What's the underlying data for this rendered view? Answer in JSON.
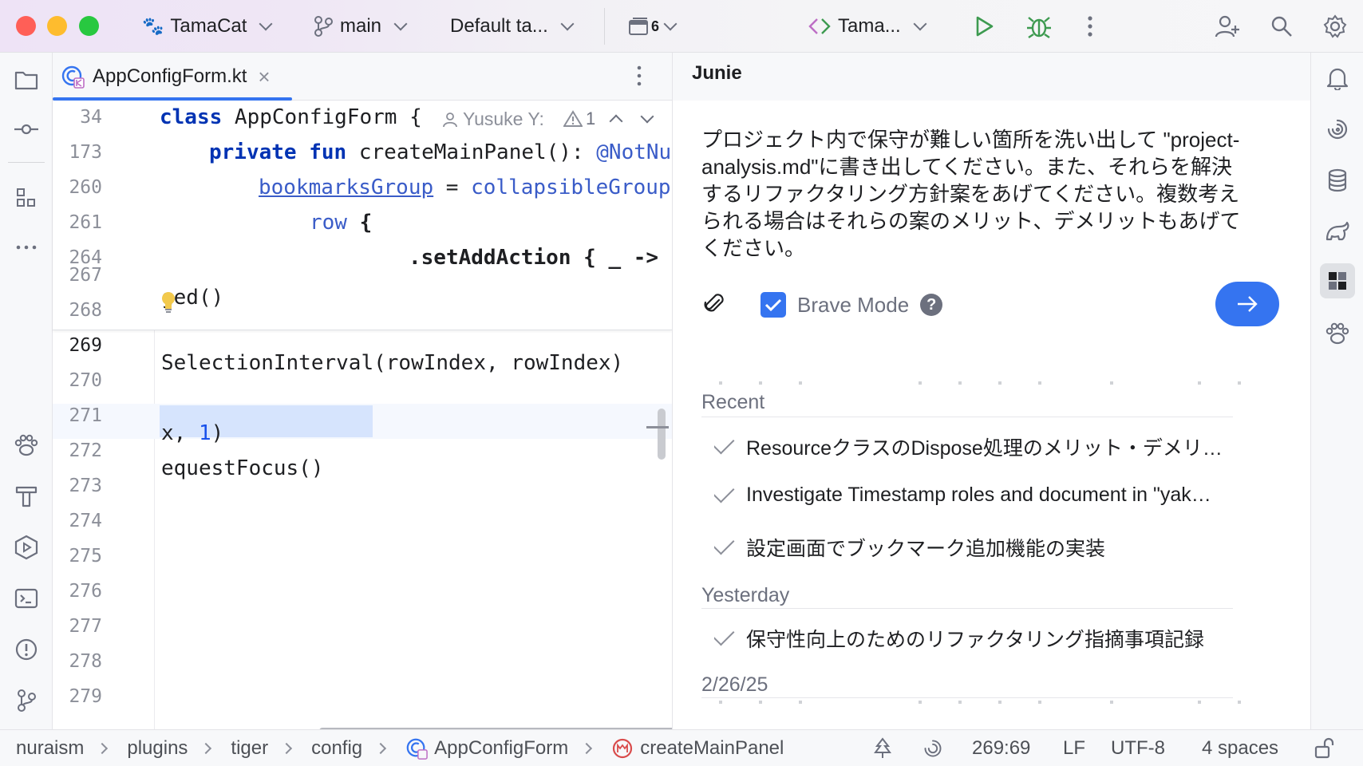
{
  "titlebar": {
    "project": "TamaCat",
    "branch": "main",
    "task": "Default ta...",
    "windows_count": "6",
    "run_config": "Tama...",
    "colors": {
      "close": "#ff5f57",
      "minimize": "#febc2e",
      "maximize": "#28c840",
      "run": "#3d9a50",
      "debug": "#3d9a50"
    }
  },
  "left_strip": {
    "items": [
      "project-icon",
      "commit-icon",
      "structure-icon",
      "more-icon",
      "paw-icon",
      "build-icon",
      "run-icon",
      "terminal-icon",
      "problems-icon",
      "git-icon"
    ]
  },
  "right_strip": {
    "items": [
      "notifications-icon",
      "ai-assistant-icon",
      "database-icon",
      "gradle-icon",
      "junie-icon",
      "paw-icon"
    ]
  },
  "editor": {
    "tab": {
      "label": "AppConfigForm.kt",
      "close": "×"
    },
    "sticky_lines": [
      {
        "num": "34"
      },
      {
        "num": "173"
      },
      {
        "num": "260"
      },
      {
        "num": "261"
      },
      {
        "num": "264"
      }
    ],
    "sticky_code": {
      "l1_kw": "class",
      "l1_rest": " AppConfigForm {",
      "l2_kw1": "private",
      "l2_kw2": "fun",
      "l2_rest": " createMainPanel(): ",
      "l2_ann": "@NotNu",
      "l3_a": "bookmarksGroup",
      "l3_b": " = ",
      "l3_c": "collapsibleGroup",
      "l4_a": "row",
      "l4_b": " {",
      "l5": ".setAddAction { _ ->"
    },
    "inlay": {
      "author": "Yusuke Y:",
      "warnings": "1"
    },
    "lines": [
      {
        "num": "267",
        "code": "ged()"
      },
      {
        "num": "268",
        "code": ""
      },
      {
        "num": "269",
        "code_sel": "SelectionInterval",
        "code_rest": "(rowIndex, rowIndex)"
      },
      {
        "num": "270",
        "code": ""
      },
      {
        "num": "271",
        "code_a": "x, ",
        "code_num": "1",
        "code_b": ")"
      },
      {
        "num": "272",
        "code": "equestFocus()"
      },
      {
        "num": "273",
        "code": ""
      },
      {
        "num": "274",
        "code": ""
      },
      {
        "num": "275",
        "code": ""
      },
      {
        "num": "276",
        "code": ""
      },
      {
        "num": "277",
        "code": ""
      },
      {
        "num": "278",
        "code": ""
      },
      {
        "num": "279",
        "code": ""
      }
    ]
  },
  "junie": {
    "title": "Junie",
    "prompt": "プロジェクト内で保守が難しい箇所を洗い出して \"project-analysis.md\"に書き出してください。また、それらを解決するリファクタリング方針案をあげてください。複数考えられる場合はそれらの案のメリット、デメリットもあげてください。",
    "brave_mode": {
      "label": "Brave Mode",
      "checked": true,
      "help": "?"
    },
    "sections": [
      {
        "heading": "Recent",
        "items": [
          "ResourceクラスのDispose処理のメリット・デメリ…",
          "Investigate Timestamp roles and document in \"yak…",
          "設定画面でブックマーク追加機能の実装"
        ]
      },
      {
        "heading": "Yesterday",
        "items": [
          "保守性向上のためのリファクタリング指摘事項記録"
        ]
      },
      {
        "heading": "2/26/25",
        "items": []
      }
    ]
  },
  "statusbar": {
    "breadcrumbs": [
      "nuraism",
      "plugins",
      "tiger",
      "config",
      "AppConfigForm",
      "createMainPanel"
    ],
    "position": "269:69",
    "line_ending": "LF",
    "encoding": "UTF-8",
    "indent": "4 spaces"
  }
}
